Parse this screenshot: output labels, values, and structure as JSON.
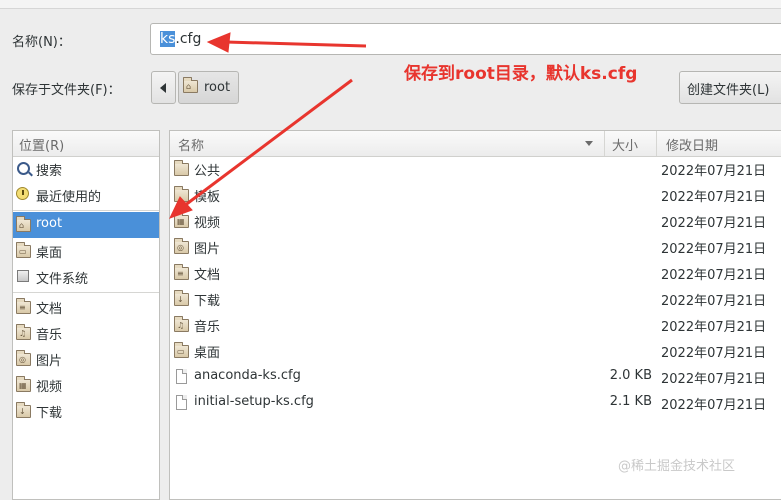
{
  "dialog": {
    "name_label": "名称(N)：",
    "name_value_selected": "ks",
    "name_value_rest": ".cfg",
    "folder_label": "保存于文件夹(F)：",
    "breadcrumb": "root",
    "create_folder_button": "创建文件夹(L)"
  },
  "places": {
    "header": "位置(R)",
    "items": [
      {
        "label": "搜索",
        "icon": "search-icon"
      },
      {
        "label": "最近使用的",
        "icon": "clock-icon"
      },
      {
        "label": "root",
        "icon": "home-folder-icon",
        "active": true
      },
      {
        "label": "桌面",
        "icon": "desktop-folder-icon"
      },
      {
        "label": "文件系统",
        "icon": "disk-icon"
      },
      {
        "label": "文档",
        "icon": "documents-folder-icon"
      },
      {
        "label": "音乐",
        "icon": "music-folder-icon"
      },
      {
        "label": "图片",
        "icon": "pictures-folder-icon"
      },
      {
        "label": "视频",
        "icon": "videos-folder-icon"
      },
      {
        "label": "下载",
        "icon": "downloads-folder-icon"
      }
    ]
  },
  "files": {
    "columns": {
      "name": "名称",
      "size": "大小",
      "date": "修改日期"
    },
    "rows": [
      {
        "name": "公共",
        "size": "",
        "date": "2022年07月21日",
        "kind": "folder"
      },
      {
        "name": "模板",
        "size": "",
        "date": "2022年07月21日",
        "kind": "folder"
      },
      {
        "name": "视频",
        "size": "",
        "date": "2022年07月21日",
        "kind": "folder"
      },
      {
        "name": "图片",
        "size": "",
        "date": "2022年07月21日",
        "kind": "folder"
      },
      {
        "name": "文档",
        "size": "",
        "date": "2022年07月21日",
        "kind": "folder"
      },
      {
        "name": "下载",
        "size": "",
        "date": "2022年07月21日",
        "kind": "folder"
      },
      {
        "name": "音乐",
        "size": "",
        "date": "2022年07月21日",
        "kind": "folder"
      },
      {
        "name": "桌面",
        "size": "",
        "date": "2022年07月21日",
        "kind": "folder"
      },
      {
        "name": "anaconda-ks.cfg",
        "size": "2.0 KB",
        "date": "2022年07月21日",
        "kind": "file"
      },
      {
        "name": "initial-setup-ks.cfg",
        "size": "2.1 KB",
        "date": "2022年07月21日",
        "kind": "file"
      }
    ]
  },
  "annotation": {
    "text": "保存到root目录，默认ks.cfg",
    "color": "#e8352e"
  },
  "watermark": "@稀土掘金技术社区",
  "colors": {
    "selection": "#4a90d9",
    "background": "#ededed"
  }
}
